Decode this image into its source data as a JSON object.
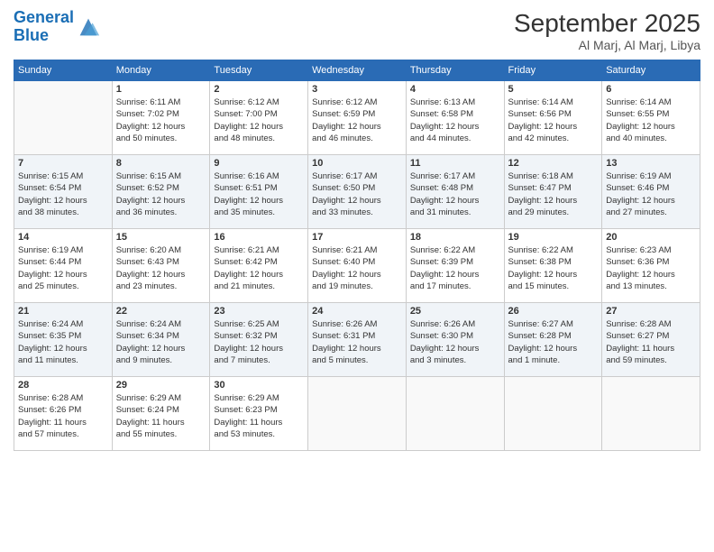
{
  "logo": {
    "line1": "General",
    "line2": "Blue"
  },
  "title": "September 2025",
  "subtitle": "Al Marj, Al Marj, Libya",
  "days_of_week": [
    "Sunday",
    "Monday",
    "Tuesday",
    "Wednesday",
    "Thursday",
    "Friday",
    "Saturday"
  ],
  "weeks": [
    [
      {
        "day": "",
        "info": ""
      },
      {
        "day": "1",
        "info": "Sunrise: 6:11 AM\nSunset: 7:02 PM\nDaylight: 12 hours\nand 50 minutes."
      },
      {
        "day": "2",
        "info": "Sunrise: 6:12 AM\nSunset: 7:00 PM\nDaylight: 12 hours\nand 48 minutes."
      },
      {
        "day": "3",
        "info": "Sunrise: 6:12 AM\nSunset: 6:59 PM\nDaylight: 12 hours\nand 46 minutes."
      },
      {
        "day": "4",
        "info": "Sunrise: 6:13 AM\nSunset: 6:58 PM\nDaylight: 12 hours\nand 44 minutes."
      },
      {
        "day": "5",
        "info": "Sunrise: 6:14 AM\nSunset: 6:56 PM\nDaylight: 12 hours\nand 42 minutes."
      },
      {
        "day": "6",
        "info": "Sunrise: 6:14 AM\nSunset: 6:55 PM\nDaylight: 12 hours\nand 40 minutes."
      }
    ],
    [
      {
        "day": "7",
        "info": "Sunrise: 6:15 AM\nSunset: 6:54 PM\nDaylight: 12 hours\nand 38 minutes."
      },
      {
        "day": "8",
        "info": "Sunrise: 6:15 AM\nSunset: 6:52 PM\nDaylight: 12 hours\nand 36 minutes."
      },
      {
        "day": "9",
        "info": "Sunrise: 6:16 AM\nSunset: 6:51 PM\nDaylight: 12 hours\nand 35 minutes."
      },
      {
        "day": "10",
        "info": "Sunrise: 6:17 AM\nSunset: 6:50 PM\nDaylight: 12 hours\nand 33 minutes."
      },
      {
        "day": "11",
        "info": "Sunrise: 6:17 AM\nSunset: 6:48 PM\nDaylight: 12 hours\nand 31 minutes."
      },
      {
        "day": "12",
        "info": "Sunrise: 6:18 AM\nSunset: 6:47 PM\nDaylight: 12 hours\nand 29 minutes."
      },
      {
        "day": "13",
        "info": "Sunrise: 6:19 AM\nSunset: 6:46 PM\nDaylight: 12 hours\nand 27 minutes."
      }
    ],
    [
      {
        "day": "14",
        "info": "Sunrise: 6:19 AM\nSunset: 6:44 PM\nDaylight: 12 hours\nand 25 minutes."
      },
      {
        "day": "15",
        "info": "Sunrise: 6:20 AM\nSunset: 6:43 PM\nDaylight: 12 hours\nand 23 minutes."
      },
      {
        "day": "16",
        "info": "Sunrise: 6:21 AM\nSunset: 6:42 PM\nDaylight: 12 hours\nand 21 minutes."
      },
      {
        "day": "17",
        "info": "Sunrise: 6:21 AM\nSunset: 6:40 PM\nDaylight: 12 hours\nand 19 minutes."
      },
      {
        "day": "18",
        "info": "Sunrise: 6:22 AM\nSunset: 6:39 PM\nDaylight: 12 hours\nand 17 minutes."
      },
      {
        "day": "19",
        "info": "Sunrise: 6:22 AM\nSunset: 6:38 PM\nDaylight: 12 hours\nand 15 minutes."
      },
      {
        "day": "20",
        "info": "Sunrise: 6:23 AM\nSunset: 6:36 PM\nDaylight: 12 hours\nand 13 minutes."
      }
    ],
    [
      {
        "day": "21",
        "info": "Sunrise: 6:24 AM\nSunset: 6:35 PM\nDaylight: 12 hours\nand 11 minutes."
      },
      {
        "day": "22",
        "info": "Sunrise: 6:24 AM\nSunset: 6:34 PM\nDaylight: 12 hours\nand 9 minutes."
      },
      {
        "day": "23",
        "info": "Sunrise: 6:25 AM\nSunset: 6:32 PM\nDaylight: 12 hours\nand 7 minutes."
      },
      {
        "day": "24",
        "info": "Sunrise: 6:26 AM\nSunset: 6:31 PM\nDaylight: 12 hours\nand 5 minutes."
      },
      {
        "day": "25",
        "info": "Sunrise: 6:26 AM\nSunset: 6:30 PM\nDaylight: 12 hours\nand 3 minutes."
      },
      {
        "day": "26",
        "info": "Sunrise: 6:27 AM\nSunset: 6:28 PM\nDaylight: 12 hours\nand 1 minute."
      },
      {
        "day": "27",
        "info": "Sunrise: 6:28 AM\nSunset: 6:27 PM\nDaylight: 11 hours\nand 59 minutes."
      }
    ],
    [
      {
        "day": "28",
        "info": "Sunrise: 6:28 AM\nSunset: 6:26 PM\nDaylight: 11 hours\nand 57 minutes."
      },
      {
        "day": "29",
        "info": "Sunrise: 6:29 AM\nSunset: 6:24 PM\nDaylight: 11 hours\nand 55 minutes."
      },
      {
        "day": "30",
        "info": "Sunrise: 6:29 AM\nSunset: 6:23 PM\nDaylight: 11 hours\nand 53 minutes."
      },
      {
        "day": "",
        "info": ""
      },
      {
        "day": "",
        "info": ""
      },
      {
        "day": "",
        "info": ""
      },
      {
        "day": "",
        "info": ""
      }
    ]
  ]
}
